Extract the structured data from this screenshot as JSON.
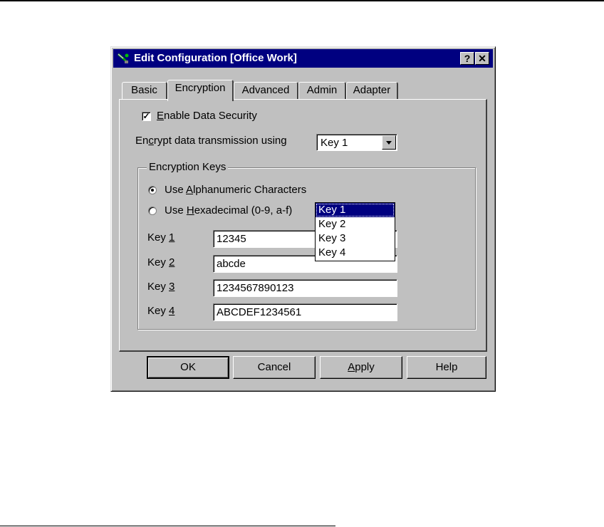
{
  "window": {
    "title": "Edit Configuration [Office Work]",
    "help_glyph": "?",
    "close_glyph": "✕"
  },
  "tabs": [
    {
      "label": "Basic"
    },
    {
      "label": "Encryption",
      "active": true
    },
    {
      "label": "Advanced"
    },
    {
      "label": "Admin"
    },
    {
      "label": "Adapter"
    }
  ],
  "encryption": {
    "enable_label": {
      "pre": "",
      "hot": "E",
      "post": "nable Data Security"
    },
    "enable_checked": true,
    "check_glyph": "✓",
    "encrypt_using_label": {
      "pre": "En",
      "hot": "c",
      "post": "rypt data transmission using"
    },
    "encrypt_using_value": "Key 1",
    "dropdown_options": [
      "Key 1",
      "Key 2",
      "Key 3",
      "Key 4"
    ],
    "dropdown_selected_index": 0,
    "keys_group_title": "Encryption Keys",
    "radio_alnum": {
      "pre": "Use ",
      "hot": "A",
      "post": "lphanumeric Characters"
    },
    "radio_hex": {
      "pre": "Use ",
      "hot": "H",
      "post": "exadecimal (0-9, a-f)"
    },
    "radio_selected": "alphanumeric",
    "keys": [
      {
        "label_pre": "Key ",
        "hot": "1",
        "value": "12345"
      },
      {
        "label_pre": "Key ",
        "hot": "2",
        "value": "abcde"
      },
      {
        "label_pre": "Key ",
        "hot": "3",
        "value": "1234567890123"
      },
      {
        "label_pre": "Key ",
        "hot": "4",
        "value": "ABCDEF1234561"
      }
    ]
  },
  "buttons": {
    "ok": "OK",
    "cancel": "Cancel",
    "apply": {
      "pre": "",
      "hot": "A",
      "post": "pply"
    },
    "help": "Help"
  },
  "colors": {
    "titlebar": "#000080",
    "face": "#c0c0c0",
    "selection": "#000080"
  }
}
